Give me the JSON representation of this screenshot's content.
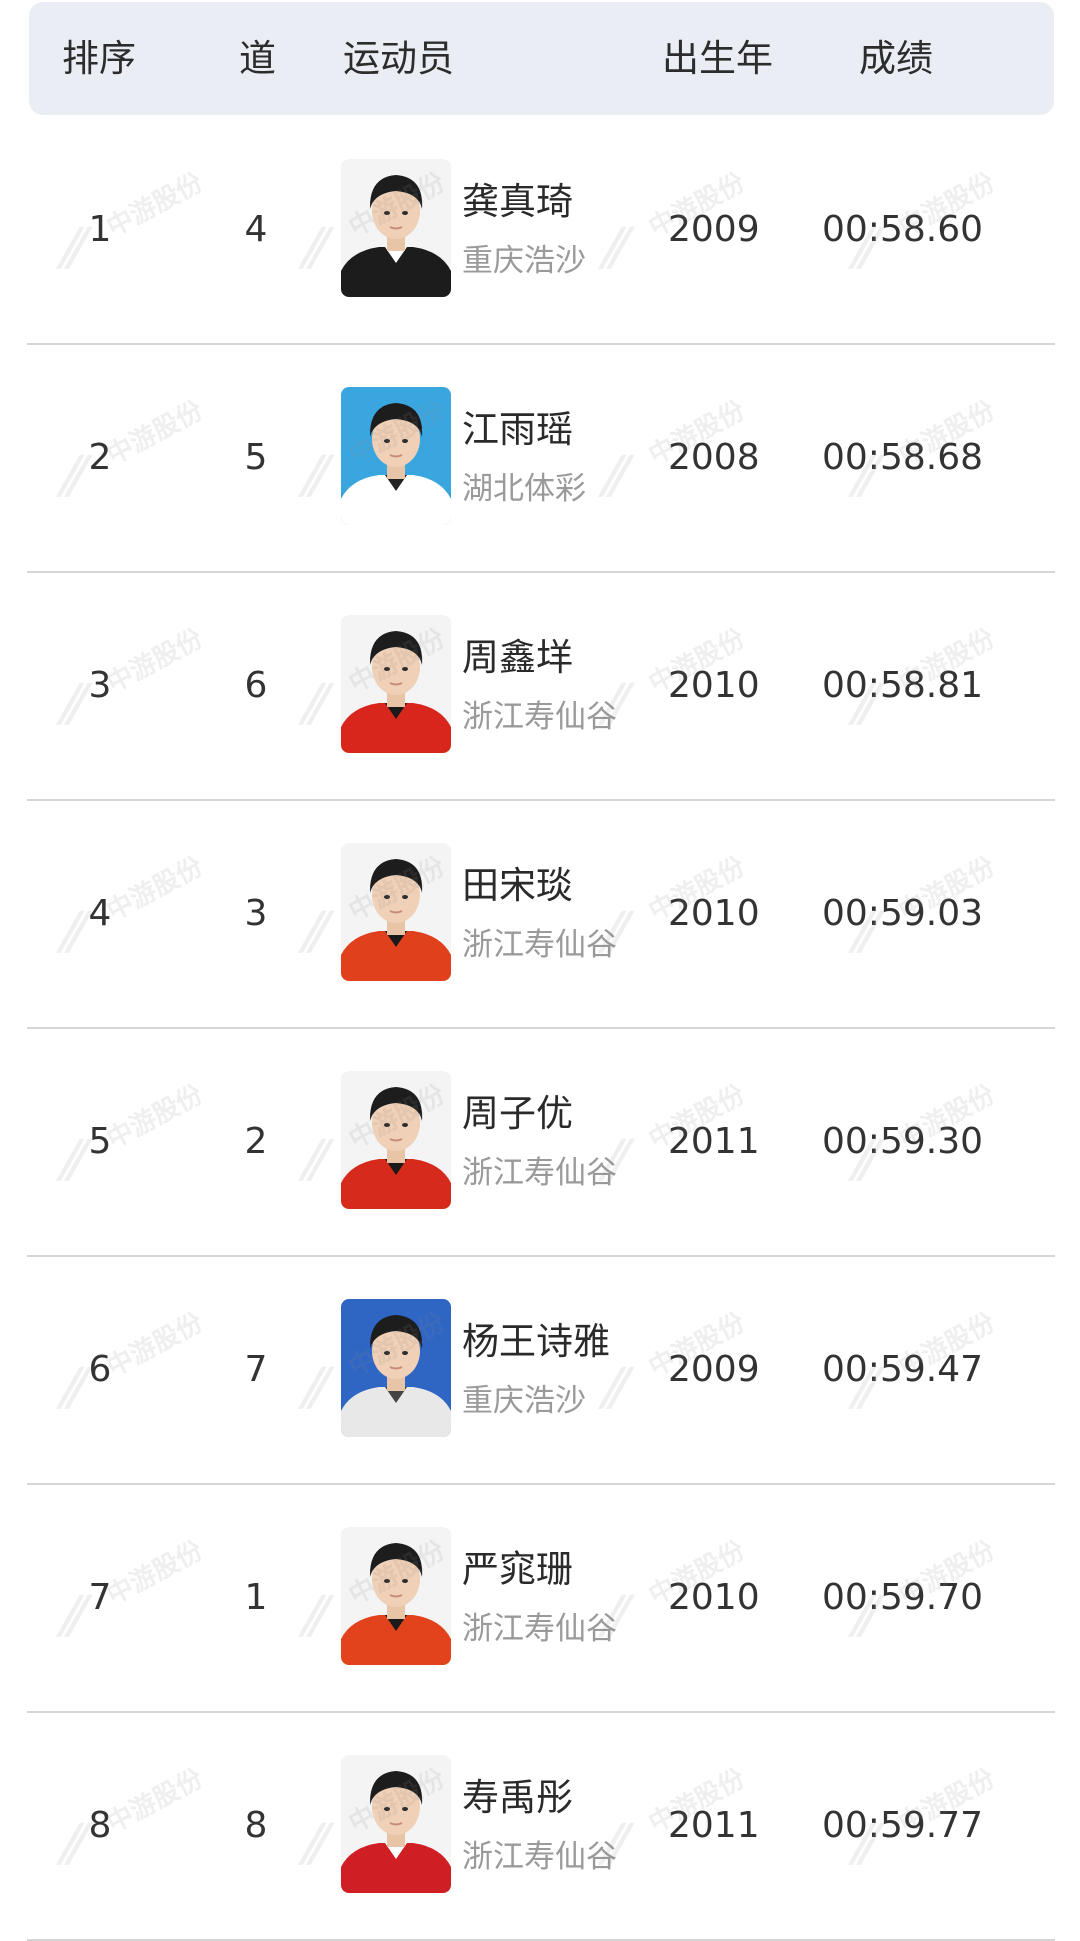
{
  "header": {
    "rank": "排序",
    "lane": "道",
    "athlete": "运动员",
    "birth_year": "出生年",
    "result": "成绩"
  },
  "watermark": {
    "text": "中游股份"
  },
  "rows": [
    {
      "rank": "1",
      "lane": "4",
      "name": "龚真琦",
      "team": "重庆浩沙",
      "birth_year": "2009",
      "result": "00:58.60",
      "photo": {
        "bg": "#f4f4f4",
        "shirt": "#1c1c1c",
        "accent": "#ffffff"
      }
    },
    {
      "rank": "2",
      "lane": "5",
      "name": "江雨瑶",
      "team": "湖北体彩",
      "birth_year": "2008",
      "result": "00:58.68",
      "photo": {
        "bg": "#3aa6e0",
        "shirt": "#ffffff",
        "accent": "#222222"
      }
    },
    {
      "rank": "3",
      "lane": "6",
      "name": "周鑫垟",
      "team": "浙江寿仙谷",
      "birth_year": "2010",
      "result": "00:58.81",
      "photo": {
        "bg": "#f4f4f4",
        "shirt": "#d8261c",
        "accent": "#1a1a1a"
      }
    },
    {
      "rank": "4",
      "lane": "3",
      "name": "田宋琰",
      "team": "浙江寿仙谷",
      "birth_year": "2010",
      "result": "00:59.03",
      "photo": {
        "bg": "#f4f4f4",
        "shirt": "#e0401c",
        "accent": "#1a1a1a"
      }
    },
    {
      "rank": "5",
      "lane": "2",
      "name": "周子优",
      "team": "浙江寿仙谷",
      "birth_year": "2011",
      "result": "00:59.30",
      "photo": {
        "bg": "#f4f4f4",
        "shirt": "#d52a1c",
        "accent": "#1a1a1a"
      }
    },
    {
      "rank": "6",
      "lane": "7",
      "name": "杨王诗雅",
      "team": "重庆浩沙",
      "birth_year": "2009",
      "result": "00:59.47",
      "photo": {
        "bg": "#2f66c4",
        "shirt": "#e8e8e8",
        "accent": "#444444"
      }
    },
    {
      "rank": "7",
      "lane": "1",
      "name": "严窕珊",
      "team": "浙江寿仙谷",
      "birth_year": "2010",
      "result": "00:59.70",
      "photo": {
        "bg": "#f4f4f4",
        "shirt": "#e2421c",
        "accent": "#1a1a1a"
      }
    },
    {
      "rank": "8",
      "lane": "8",
      "name": "寿禹彤",
      "team": "浙江寿仙谷",
      "birth_year": "2011",
      "result": "00:59.77",
      "photo": {
        "bg": "#f4f4f4",
        "shirt": "#d01e25",
        "accent": "#ffffff"
      }
    }
  ]
}
